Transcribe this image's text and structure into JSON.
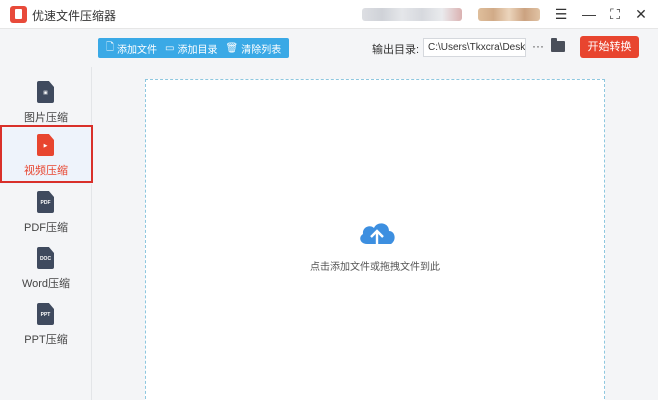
{
  "window": {
    "title": "优速文件压缩器",
    "controls": [
      "menu-icon",
      "minimize-icon",
      "maximize-icon",
      "close-icon"
    ]
  },
  "toolbar": {
    "add_file_label": "添加文件",
    "add_folder_label": "添加目录",
    "clear_list_label": "清除列表",
    "output_label": "输出目录:",
    "output_path": "C:\\Users\\Tkxcra\\Desktop",
    "more_label": "···",
    "start_label": "开始转换"
  },
  "sidebar": {
    "items": [
      {
        "label": "图片压缩",
        "icon": "image-file-icon",
        "glyph": "▣",
        "active": false
      },
      {
        "label": "视频压缩",
        "icon": "video-file-icon",
        "glyph": "▶",
        "active": true
      },
      {
        "label": "PDF压缩",
        "icon": "pdf-file-icon",
        "glyph": "PDF",
        "active": false
      },
      {
        "label": "Word压缩",
        "icon": "word-file-icon",
        "glyph": "DOC",
        "active": false
      },
      {
        "label": "PPT压缩",
        "icon": "ppt-file-icon",
        "glyph": "PPT",
        "active": false
      }
    ]
  },
  "dropzone": {
    "hint": "点击添加文件或拖拽文件到此",
    "icon": "cloud-upload-icon"
  },
  "colors": {
    "accent_blue": "#3aa9e6",
    "accent_red": "#e8452f",
    "annotation_red": "#d9302a",
    "icon_dark": "#3f4a5e",
    "cloud_blue": "#3d8fe0"
  }
}
